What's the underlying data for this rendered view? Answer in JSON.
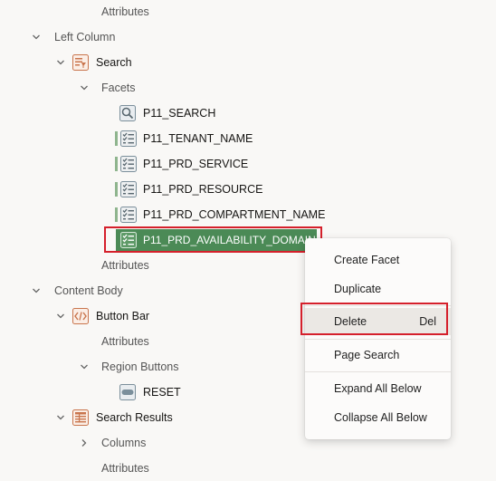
{
  "tree": {
    "attributes_top": "Attributes",
    "left_column": "Left Column",
    "search_region": "Search",
    "facets_group": "Facets",
    "facets": [
      {
        "label": "P11_SEARCH",
        "icon": "magnifier-icon"
      },
      {
        "label": "P11_TENANT_NAME",
        "icon": "checklist-icon"
      },
      {
        "label": "P11_PRD_SERVICE",
        "icon": "checklist-icon"
      },
      {
        "label": "P11_PRD_RESOURCE",
        "icon": "checklist-icon"
      },
      {
        "label": "P11_PRD_COMPARTMENT_NAME",
        "icon": "checklist-icon"
      },
      {
        "label": "P11_PRD_AVAILABILITY_DOMAIN",
        "icon": "checklist-icon",
        "selected": true
      }
    ],
    "search_attributes": "Attributes",
    "content_body": "Content Body",
    "button_bar": "Button Bar",
    "button_bar_attributes": "Attributes",
    "region_buttons": "Region Buttons",
    "reset_button": "RESET",
    "search_results": "Search Results",
    "columns": "Columns",
    "search_results_attributes": "Attributes"
  },
  "context_menu": {
    "create_facet": "Create Facet",
    "duplicate": "Duplicate",
    "delete": "Delete",
    "delete_shortcut": "Del",
    "page_search": "Page Search",
    "expand_all_below": "Expand All Below",
    "collapse_all_below": "Collapse All Below"
  },
  "colors": {
    "background": "#f9f8f6",
    "selection": "#4b8a56",
    "highlight_box": "#d5202b",
    "region_icon": "#c9754d",
    "facet_icon": "#7b8f9b"
  }
}
